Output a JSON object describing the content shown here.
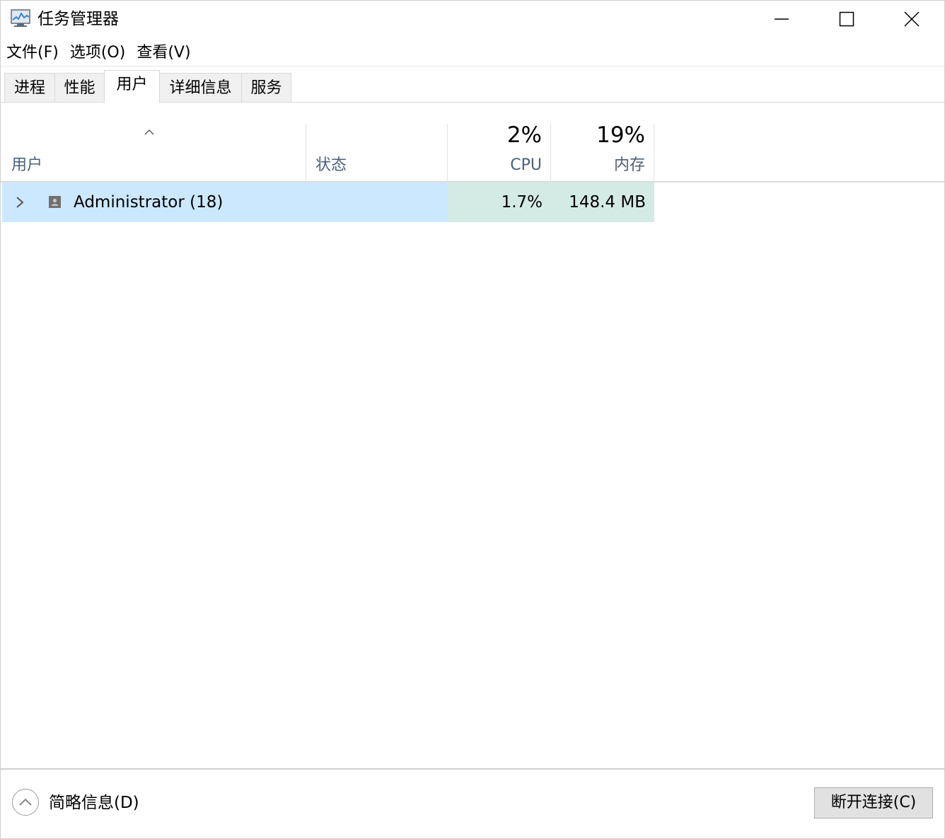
{
  "window": {
    "title": "任务管理器",
    "icons": {
      "app": "task-manager-icon",
      "minimize": "minimize-icon",
      "maximize": "maximize-icon",
      "close": "close-icon"
    }
  },
  "menu": {
    "items": [
      "文件(F)",
      "选项(O)",
      "查看(V)"
    ]
  },
  "tabs": {
    "items": [
      "进程",
      "性能",
      "用户",
      "详细信息",
      "服务"
    ],
    "active": "用户"
  },
  "columns": {
    "user": {
      "label": "用户",
      "sort": "ascending"
    },
    "status": {
      "label": "状态"
    },
    "cpu": {
      "label": "CPU",
      "total": "2%"
    },
    "memory": {
      "label": "内存",
      "total": "19%"
    }
  },
  "rows": [
    {
      "user": "Administrator (18)",
      "status": "",
      "cpu": "1.7%",
      "memory": "148.4 MB",
      "selected": true
    }
  ],
  "footer": {
    "fewer_details": "简略信息(D)",
    "disconnect": "断开连接(C)"
  },
  "colors": {
    "selection": "#cce8ff",
    "heat": "#d4ebe5",
    "header_label": "#4c607a"
  }
}
